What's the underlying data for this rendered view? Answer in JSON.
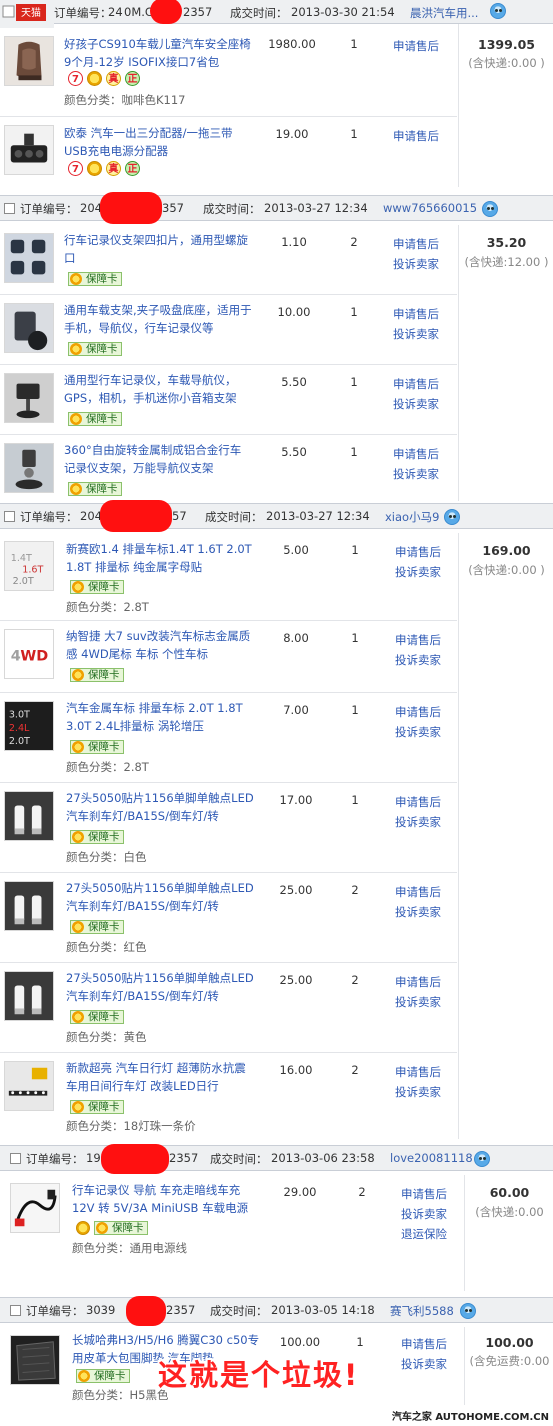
{
  "labels": {
    "order_no": "订单编号：",
    "deal_time": "成交时间：",
    "apply_after_sale": "申请售后",
    "complain": "投诉卖家",
    "return_insurance": "退运保险",
    "variant_prefix": "颜色分类：",
    "guarantee": "保障卡"
  },
  "watermark": "汽车之家 AUTOHOME.COM.CN",
  "overlay_text": "这就是个垃圾!",
  "tmall_badge": "天猫",
  "orders": [
    {
      "order_no_prefix": "24",
      "order_no_mid": "0M.CN",
      "order_no_suffix": "2357",
      "time": "2013-03-30 21:54",
      "seller": "晨洪汽车用...",
      "total": "1399.05",
      "shipping": "(含快递:0.00 )",
      "items": [
        {
          "title": "好孩子CS910车载儿童汽车安全座椅 9个月-12岁 ISOFIX接口7省包",
          "price": "1980.00",
          "qty": "1",
          "variant": "咖啡色K117",
          "thumb_icon": "child-seat-photo"
        },
        {
          "title": "欧泰 汽车一出三分配器/一拖三带USB充电电源分配器",
          "price": "19.00",
          "qty": "1",
          "variant": "",
          "thumb_icon": "socket-splitter-photo"
        }
      ]
    },
    {
      "order_no_prefix": "204",
      "order_no_suffix": "357",
      "time": "2013-03-27 12:34",
      "seller": "www765660015",
      "total": "35.20",
      "shipping": "(含快递:12.00 )",
      "items": [
        {
          "title": "行车记录仪支架四扣片，通用型螺旋口",
          "price": "1.10",
          "qty": "2",
          "thumb_icon": "mount-clips-photo"
        },
        {
          "title": "通用车载支架,夹子吸盘底座，适用于手机，导航仪，行车记录仪等",
          "price": "10.00",
          "qty": "1",
          "thumb_icon": "suction-mount-photo"
        },
        {
          "title": "通用型行车记录仪，车载导航仪，GPS，相机，手机迷你小音箱支架",
          "price": "5.50",
          "qty": "1",
          "thumb_icon": "mini-mount-photo"
        },
        {
          "title": "360°自由旋转金属制成铝合金行车记录仪支架，万能导航仪支架",
          "price": "5.50",
          "qty": "1",
          "thumb_icon": "rotating-mount-photo"
        }
      ]
    },
    {
      "order_no_prefix": "204",
      "order_no_suffix": "57",
      "time": "2013-03-27 12:34",
      "seller": "xiao小马9",
      "total": "169.00",
      "shipping": "(含快递:0.00 )",
      "items": [
        {
          "title": "新赛欧1.4 排量车标1.4T 1.6T 2.0T 1.8T 排量标 纯金属字母贴",
          "price": "5.00",
          "qty": "1",
          "variant": "2.8T",
          "thumb_icon": "displacement-badge-photo"
        },
        {
          "title": "纳智捷 大7 suv改装汽车标志金属质感 4WD尾标 车标 个性车标",
          "price": "8.00",
          "qty": "1",
          "variant": "",
          "thumb_icon": "4wd-badge-photo"
        },
        {
          "title": "汽车金属车标 排量车标 2.0T 1.8T 3.0T 2.4L排量标 涡轮增压",
          "price": "7.00",
          "qty": "1",
          "variant": "2.8T",
          "thumb_icon": "turbo-badge-photo"
        },
        {
          "title": "27头5050贴片1156单脚单触点LED汽车刹车灯/BA15S/倒车灯/转",
          "price": "17.00",
          "qty": "1",
          "variant": "白色",
          "thumb_icon": "led-bulb-photo"
        },
        {
          "title": "27头5050贴片1156单脚单触点LED汽车刹车灯/BA15S/倒车灯/转",
          "price": "25.00",
          "qty": "2",
          "variant": "红色",
          "thumb_icon": "led-bulb-photo"
        },
        {
          "title": "27头5050贴片1156单脚单触点LED汽车刹车灯/BA15S/倒车灯/转",
          "price": "25.00",
          "qty": "2",
          "variant": "黄色",
          "thumb_icon": "led-bulb-photo"
        },
        {
          "title": "新款超亮 汽车日行灯 超薄防水抗震车用日间行车灯 改装LED日行",
          "price": "16.00",
          "qty": "2",
          "variant": "18灯珠一条价",
          "thumb_icon": "daytime-light-photo"
        }
      ]
    },
    {
      "order_no_prefix": "19",
      "order_no_suffix": "2357",
      "time": "2013-03-06 23:58",
      "seller": "love20081118",
      "total": "60.00",
      "shipping": "(含快递:0.00",
      "items": [
        {
          "title": "行车记录仪 导航 车充走暗线车充12V 转 5V/3A MiniUSB 车载电源",
          "price": "29.00",
          "qty": "2",
          "variant": "通用电源线",
          "thumb_icon": "power-cable-photo"
        }
      ]
    },
    {
      "order_no_prefix": "3039",
      "order_no_suffix": "2357",
      "time": "2013-03-05 14:18",
      "seller": "赛飞利5588",
      "total": "100.00",
      "shipping": "(含免运费:0.00",
      "items": [
        {
          "title": "长城哈弗H3/H5/H6 腾翼C30 c50专用皮革大包围脚垫 汽车脚垫",
          "price": "100.00",
          "qty": "1",
          "variant": "H5黑色",
          "thumb_icon": "floor-mat-photo"
        }
      ]
    }
  ]
}
